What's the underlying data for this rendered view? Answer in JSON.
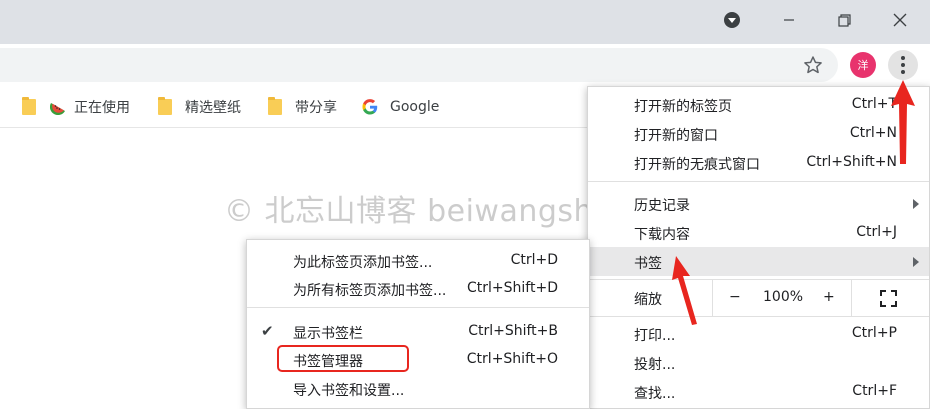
{
  "window": {
    "profile_badge": "洋",
    "icons": [
      "tab-search-icon",
      "minimize-icon",
      "restore-icon",
      "close-icon",
      "bookmark-star-icon",
      "more-menu-icon"
    ]
  },
  "bookmarks_bar": {
    "items": [
      {
        "label": "",
        "icon": "folder-icon"
      },
      {
        "label": "正在使用",
        "icon": "watermelon-icon"
      },
      {
        "label": "精选壁纸",
        "icon": "folder-icon"
      },
      {
        "label": "带分享",
        "icon": "folder-icon"
      },
      {
        "label": "Google",
        "icon": "google-icon"
      }
    ]
  },
  "watermark": "© 北忘山博客 beiwangshan.com",
  "main_menu": {
    "items": [
      {
        "label": "打开新的标签页",
        "shortcut": "Ctrl+T"
      },
      {
        "label": "打开新的窗口",
        "shortcut": "Ctrl+N"
      },
      {
        "label": "打开新的无痕式窗口",
        "shortcut": "Ctrl+Shift+N"
      },
      {
        "label": "历史记录",
        "shortcut": ""
      },
      {
        "label": "下载内容",
        "shortcut": "Ctrl+J"
      },
      {
        "label": "书签",
        "shortcut": ""
      },
      {
        "label": "打印...",
        "shortcut": "Ctrl+P"
      },
      {
        "label": "投射...",
        "shortcut": ""
      },
      {
        "label": "查找...",
        "shortcut": "Ctrl+F"
      }
    ],
    "zoom": {
      "label": "缩放",
      "minus": "−",
      "value": "100%",
      "plus": "+"
    }
  },
  "bookmarks_submenu": {
    "items": [
      {
        "label": "为此标签页添加书签...",
        "shortcut": "Ctrl+D"
      },
      {
        "label": "为所有标签页添加书签...",
        "shortcut": "Ctrl+Shift+D"
      },
      {
        "label": "显示书签栏",
        "shortcut": "Ctrl+Shift+B",
        "checked": true
      },
      {
        "label": "书签管理器",
        "shortcut": "Ctrl+Shift+O"
      },
      {
        "label": "导入书签和设置...",
        "shortcut": ""
      }
    ]
  },
  "colors": {
    "titlebar": "#dee1e6",
    "avatar": "#e8336d",
    "annotation_red": "#e8261f",
    "highlight": "#e8e8e9"
  }
}
